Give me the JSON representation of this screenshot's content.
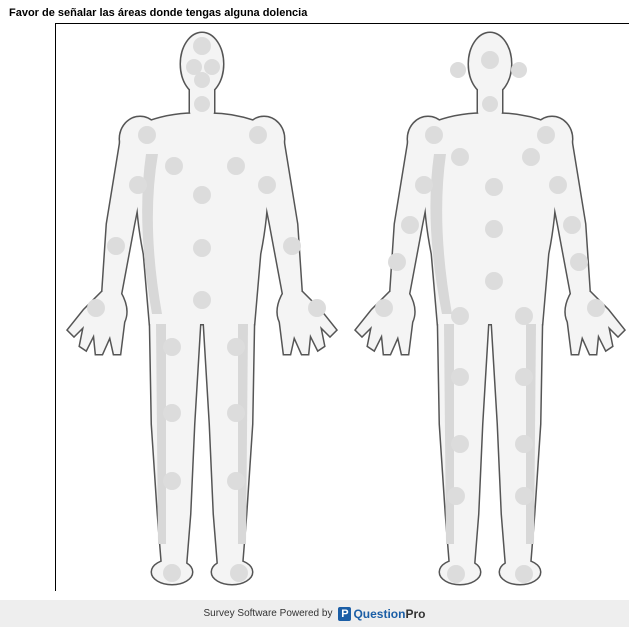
{
  "survey": {
    "question_text": "Favor de señalar las áreas donde tengas alguna dolencia"
  },
  "figures": {
    "front": {
      "name": "front-body-figure"
    },
    "back": {
      "name": "back-body-figure"
    }
  },
  "footer": {
    "text": "Survey Software Powered by",
    "brand_mark": "P",
    "brand_part1": "Question",
    "brand_part2": "Pro",
    "brand_color": "#1b5ea6"
  },
  "colors": {
    "hotspot": "#dcdcdc",
    "body_fill": "#f4f4f4",
    "body_shadow": "#d4d4d4",
    "body_outline": "#555555"
  }
}
